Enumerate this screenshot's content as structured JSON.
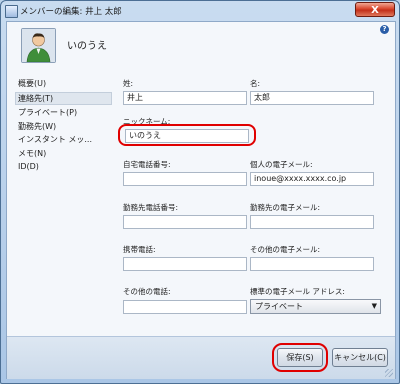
{
  "window": {
    "title": "メンバーの編集: 井上 太郎",
    "close_symbol": "X"
  },
  "header": {
    "display_name": "いのうえ",
    "help_symbol": "?",
    "avatar_icon": "person-avatar-icon"
  },
  "sidebar": {
    "items": [
      {
        "label": "概要(U)"
      },
      {
        "label": "連絡先(T)",
        "selected": true
      },
      {
        "label": "プライベート(P)"
      },
      {
        "label": "勤務先(W)"
      },
      {
        "label": "インスタント メッ..."
      },
      {
        "label": "メモ(N)"
      },
      {
        "label": "ID(D)"
      }
    ]
  },
  "form": {
    "last_name": {
      "label": "姓:",
      "value": "井上"
    },
    "first_name": {
      "label": "名:",
      "value": "太郎"
    },
    "nickname": {
      "label": "ニックネーム:",
      "value": "いのうえ"
    },
    "home_phone": {
      "label": "自宅電話番号:",
      "value": ""
    },
    "personal_email": {
      "label": "個人の電子メール:",
      "value": "inoue@xxxx.xxxx.co.jp"
    },
    "work_phone": {
      "label": "勤務先電話番号:",
      "value": ""
    },
    "work_email": {
      "label": "勤務先の電子メール:",
      "value": ""
    },
    "mobile_phone": {
      "label": "携帯電話:",
      "value": ""
    },
    "other_email": {
      "label": "その他の電子メール:",
      "value": ""
    },
    "other_phone": {
      "label": "その他の電話:",
      "value": ""
    },
    "default_email": {
      "label": "標準の電子メール アドレス:",
      "value": "プライベート"
    }
  },
  "footer": {
    "save_label": "保存(S)",
    "cancel_label": "キャンセル(C)"
  },
  "colors": {
    "highlight": "#e00000",
    "title_bar": "#bcd3ea",
    "close_button": "#c2301a"
  }
}
